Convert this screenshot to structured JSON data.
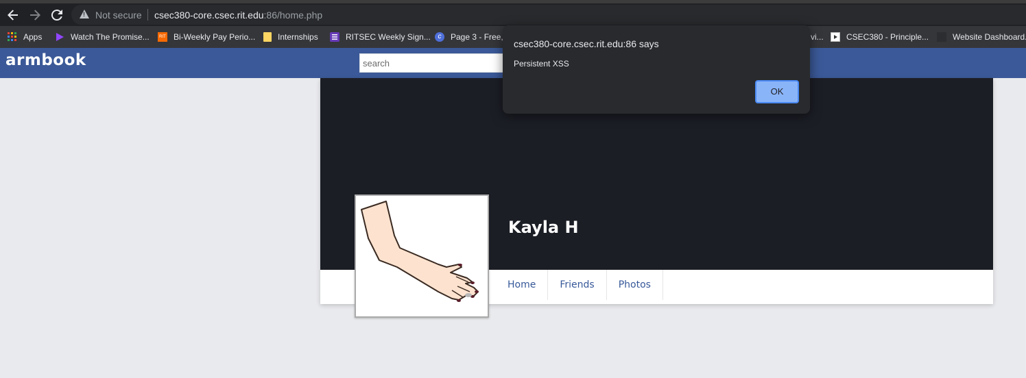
{
  "browser": {
    "security_label": "Not secure",
    "url_host": "csec380-core.csec.rit.edu",
    "url_rest": ":86/home.php",
    "bookmarks": [
      {
        "label": "Apps",
        "icon": "apps-grid-icon"
      },
      {
        "label": "Watch The Promise...",
        "icon": "play-icon"
      },
      {
        "label": "Bi-Weekly Pay Perio...",
        "icon": "rit-icon"
      },
      {
        "label": "Internships",
        "icon": "folder-icon"
      },
      {
        "label": "RITSEC Weekly Sign...",
        "icon": "list-form-icon"
      },
      {
        "label": "Page 3 - Free,",
        "icon": "c-logo-icon"
      },
      {
        "label": "vi...",
        "icon": ""
      },
      {
        "label": "CSEC380 - Principle...",
        "icon": "slides-icon"
      },
      {
        "label": "Website Dashboard...",
        "icon": "dashboard-icon"
      }
    ]
  },
  "site": {
    "logo": "armbook",
    "search_placeholder": "search"
  },
  "profile": {
    "name": "Kayla H",
    "tabs": [
      "Home",
      "Friends",
      "Photos"
    ]
  },
  "dialog": {
    "title": "csec380-core.csec.rit.edu:86 says",
    "message": "Persistent XSS",
    "ok_label": "OK"
  },
  "colors": {
    "header_blue": "#3b5998",
    "cover_dark": "#1c1e26",
    "tab_link": "#365899",
    "ok_button": "#8ab4f8"
  }
}
